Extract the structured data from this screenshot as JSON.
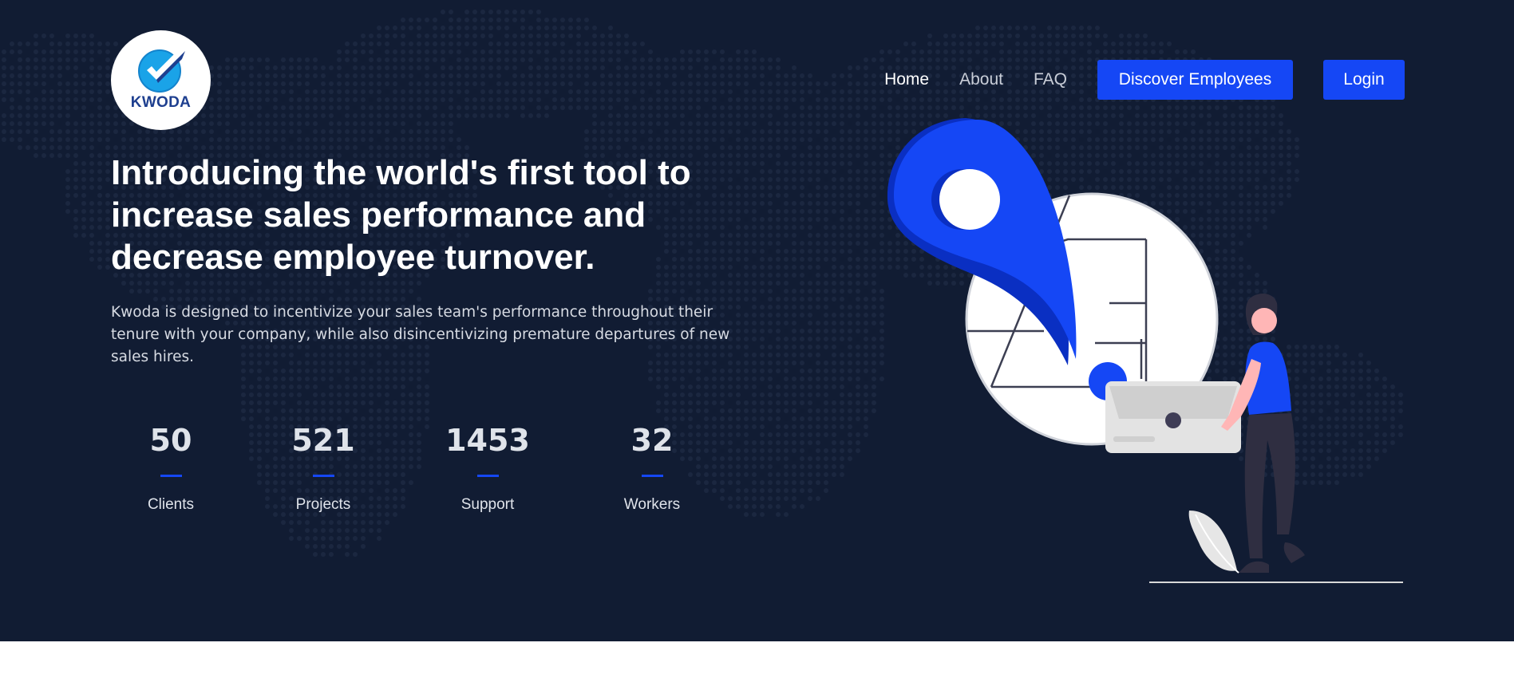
{
  "brand": {
    "name": "KWODA",
    "logo_icon": "checkmark-badge-icon"
  },
  "nav": {
    "links": [
      {
        "label": "Home",
        "active": true
      },
      {
        "label": "About",
        "active": false
      },
      {
        "label": "FAQ",
        "active": false
      }
    ],
    "discover_label": "Discover Employees",
    "login_label": "Login"
  },
  "hero": {
    "headline": "Introducing the world's first tool to increase sales performance and decrease employee turnover.",
    "subtext": "Kwoda is designed to incentivize your sales team's performance throughout their tenure with your company, while also disincentivizing premature departures of new sales hires."
  },
  "stats": [
    {
      "value": "50",
      "label": "Clients"
    },
    {
      "value": "521",
      "label": "Projects"
    },
    {
      "value": "1453",
      "label": "Support"
    },
    {
      "value": "32",
      "label": "Workers"
    }
  ],
  "colors": {
    "background": "#111c33",
    "accent": "#1547f5",
    "text": "#ffffff"
  }
}
